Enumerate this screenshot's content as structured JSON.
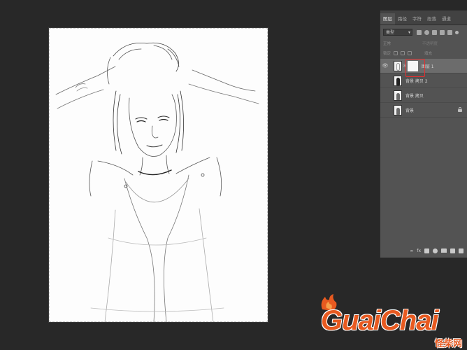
{
  "layers_panel": {
    "tabs": [
      "图层",
      "路径",
      "字符",
      "段落",
      "通道"
    ],
    "active_tab": 0,
    "filter_select": "类型",
    "blend_mode": "正常",
    "opacity_label": "不透明度",
    "lock_label": "锁定",
    "fill_label": "填充",
    "layers": [
      {
        "name": "图层 1",
        "visible": true,
        "selected": true,
        "has_mask": true,
        "locked": false
      },
      {
        "name": "背景 拷贝 2",
        "visible": false,
        "selected": false,
        "has_mask": false,
        "locked": false
      },
      {
        "name": "背景 拷贝",
        "visible": false,
        "selected": false,
        "has_mask": false,
        "locked": false
      },
      {
        "name": "背景",
        "visible": false,
        "selected": false,
        "has_mask": false,
        "locked": true
      }
    ],
    "footer_fx": "fx"
  },
  "watermark": {
    "brand": "GuaiChai",
    "subtitle": "怪柴网"
  },
  "colors": {
    "workspace": "#282828",
    "panel": "#535353",
    "selected_layer": "#6c6c6c",
    "highlight_box": "#e23030",
    "brand_orange": "#e85a20"
  }
}
